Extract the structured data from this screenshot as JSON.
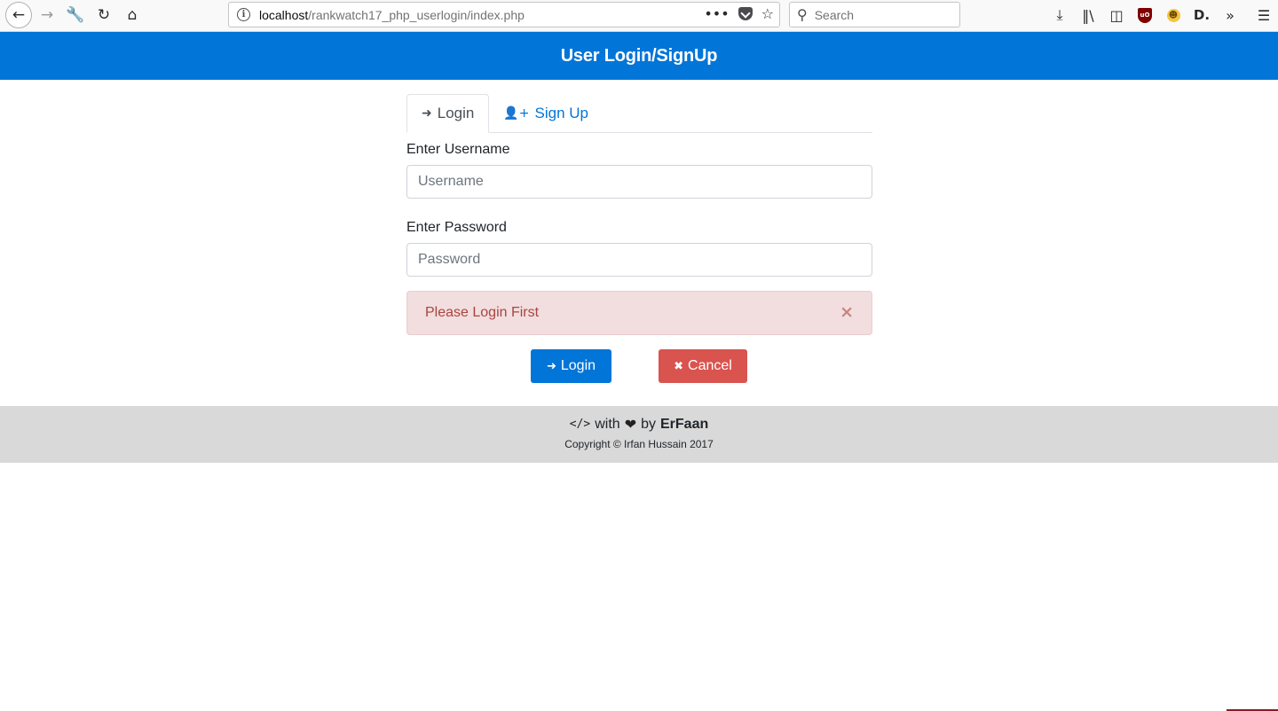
{
  "browser": {
    "url_host": "localhost",
    "url_path": "/rankwatch17_php_userlogin/index.php",
    "search_placeholder": "Search",
    "icons": [
      "back-icon",
      "forward-icon",
      "wrench-icon",
      "reload-icon",
      "home-icon",
      "info-icon",
      "more-icon",
      "pocket-icon",
      "bookmark-star-icon",
      "search-icon",
      "download-icon",
      "library-icon",
      "sidebar-icon",
      "ublock-icon",
      "emoji-icon",
      "d-extension-icon",
      "overflow-icon",
      "menu-icon"
    ]
  },
  "header": {
    "title": "User Login/SignUp",
    "background": "#0275d8"
  },
  "tabs": [
    {
      "label": "Login",
      "icon": "sign-in-icon",
      "active": true
    },
    {
      "label": "Sign Up",
      "icon": "user-plus-icon",
      "active": false
    }
  ],
  "form": {
    "username_label": "Enter Username",
    "username_placeholder": "Username",
    "username_value": "",
    "password_label": "Enter Password",
    "password_placeholder": "Password",
    "password_value": ""
  },
  "alert": {
    "message": "Please Login First",
    "close_symbol": "×",
    "background": "#f2dede"
  },
  "buttons": {
    "login_label": "Login",
    "login_color": "#0275d8",
    "cancel_label": "Cancel",
    "cancel_color": "#d9534f"
  },
  "footer": {
    "with_text": "with",
    "by_text": "by",
    "author": "ErFaan",
    "copyright": "Copyright © Irfan Hussain 2017"
  }
}
